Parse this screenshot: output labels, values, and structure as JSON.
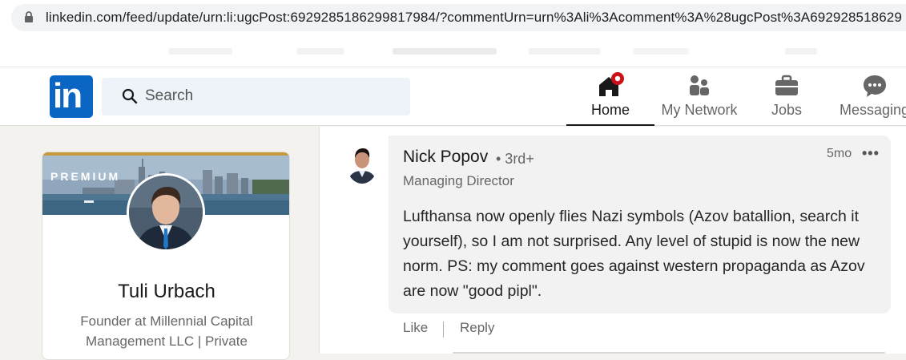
{
  "browser": {
    "url": "linkedin.com/feed/update/urn:li:ugcPost:6929285186299817984/?commentUrn=urn%3Ali%3Acomment%3A%28ugcPost%3A692928518629"
  },
  "nav": {
    "search_placeholder": "Search",
    "items": [
      {
        "label": "Home",
        "icon": "home-icon",
        "active": true
      },
      {
        "label": "My Network",
        "icon": "network-icon"
      },
      {
        "label": "Jobs",
        "icon": "briefcase-icon"
      },
      {
        "label": "Messaging",
        "icon": "messaging-icon"
      }
    ]
  },
  "profile": {
    "badge": "PREMIUM",
    "name": "Tuli Urbach",
    "headline": "Founder at Millennial Capital Management LLC | Private"
  },
  "comment": {
    "author": "Nick Popov",
    "degree": "• 3rd+",
    "title": "Managing Director",
    "time": "5mo",
    "more": "•••",
    "body": "Lufthansa now openly flies Nazi symbols (Azov batallion, search it yourself), so I am not surprised. Any level of stupid is now the new norm. PS: my comment goes against western propaganda as Azov are now \"good pipl\".",
    "like_label": "Like",
    "reply_label": "Reply"
  },
  "colors": {
    "linkedin_blue": "#0a66c2",
    "notification_red": "#cc1016",
    "premium_gold": "#c79a3f"
  }
}
